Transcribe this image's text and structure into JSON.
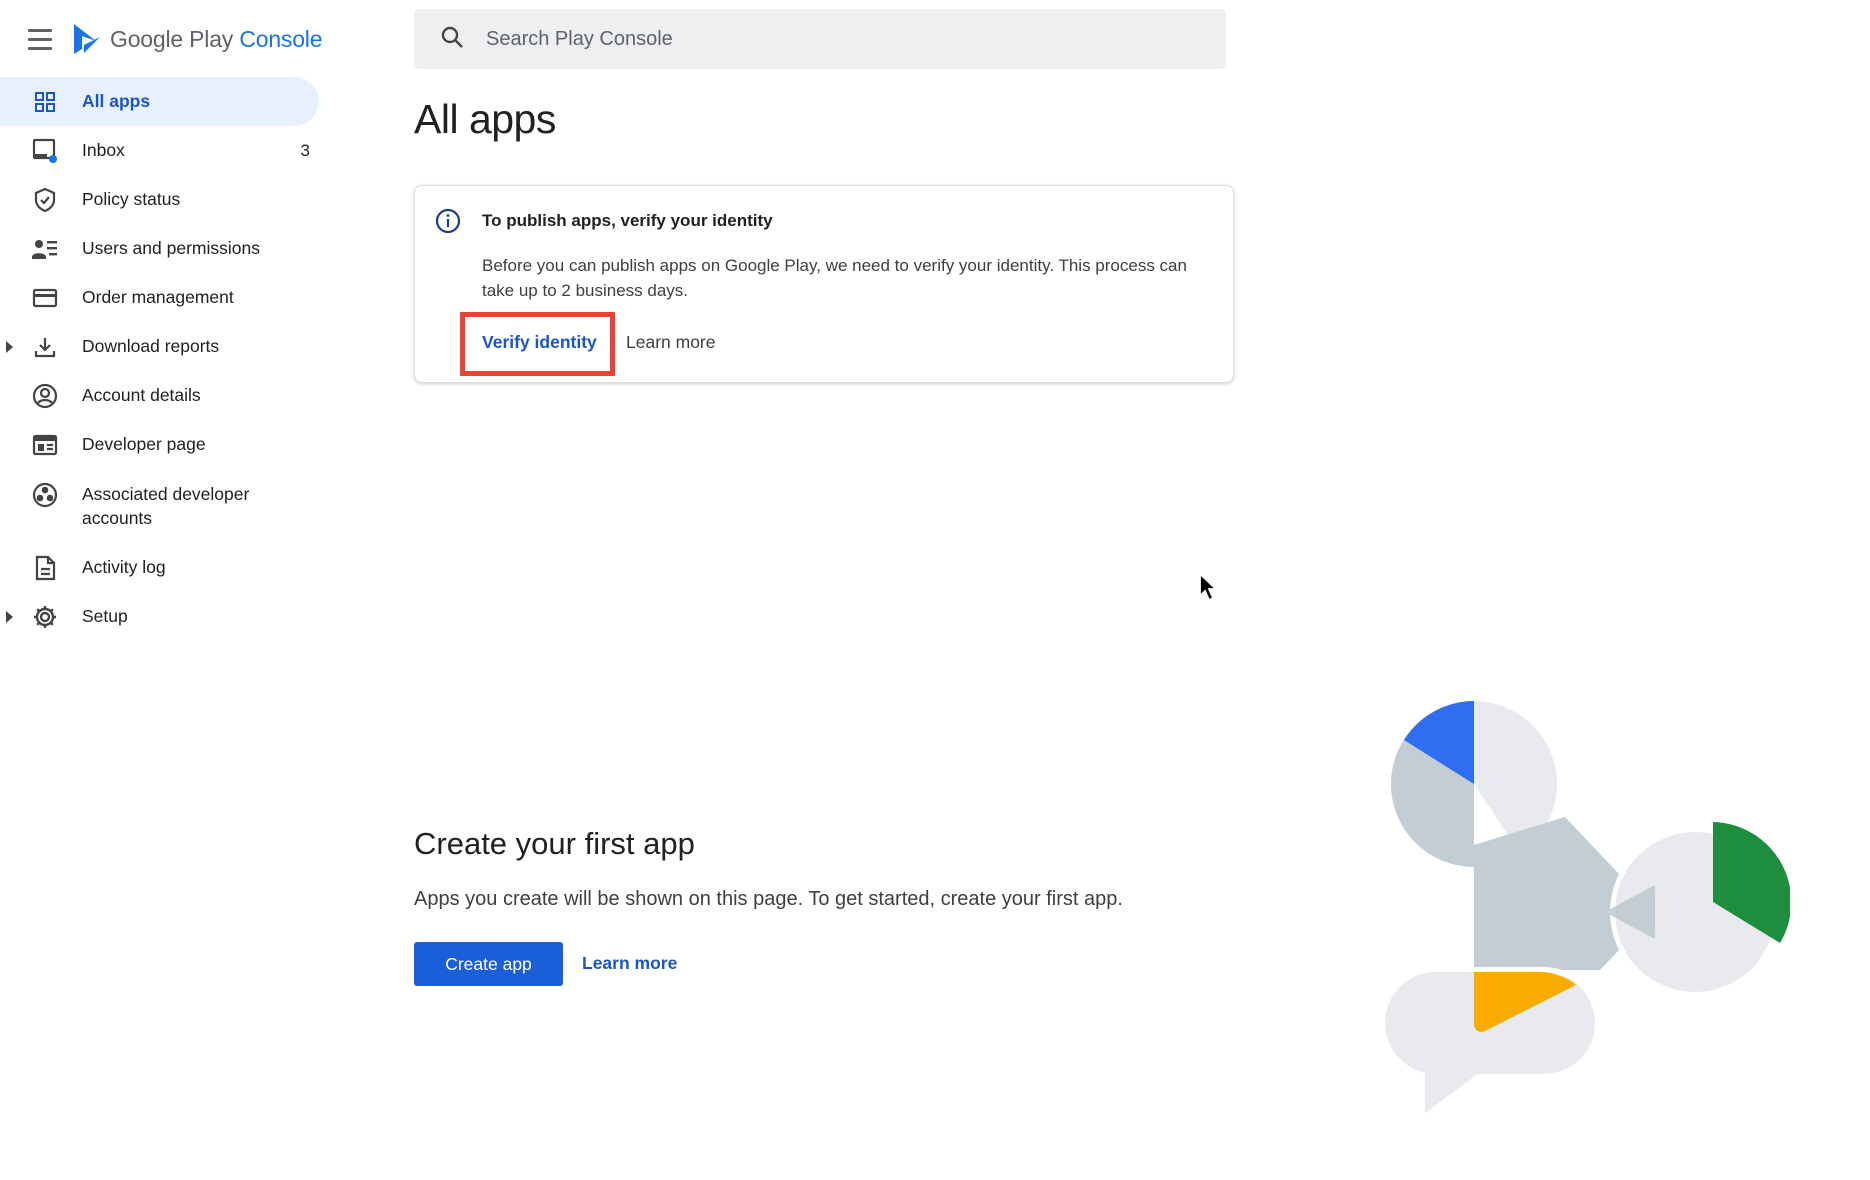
{
  "brand": {
    "google_play": "Google Play",
    "console": "Console"
  },
  "search": {
    "placeholder": "Search Play Console"
  },
  "sidebar": {
    "items": [
      {
        "label": "All apps",
        "icon": "grid-icon",
        "active": true
      },
      {
        "label": "Inbox",
        "icon": "inbox-icon",
        "count": "3"
      },
      {
        "label": "Policy status",
        "icon": "shield-check-icon"
      },
      {
        "label": "Users and permissions",
        "icon": "people-list-icon"
      },
      {
        "label": "Order management",
        "icon": "credit-card-icon"
      },
      {
        "label": "Download reports",
        "icon": "download-icon",
        "expandable": true
      },
      {
        "label": "Account details",
        "icon": "account-circle-icon"
      },
      {
        "label": "Developer page",
        "icon": "web-page-icon"
      },
      {
        "label": "Associated developer accounts",
        "icon": "linked-accounts-icon"
      },
      {
        "label": "Activity log",
        "icon": "document-icon"
      },
      {
        "label": "Setup",
        "icon": "gear-icon",
        "expandable": true
      }
    ]
  },
  "main": {
    "title": "All apps",
    "alert": {
      "title": "To publish apps, verify your identity",
      "body": "Before you can publish apps on Google Play, we need to verify your identity. This process can take up to 2 business days.",
      "verify_label": "Verify identity",
      "learn_label": "Learn more"
    },
    "create": {
      "title": "Create your first app",
      "description": "Apps you create will be shown on this page. To get started, create your first app.",
      "button_label": "Create app",
      "learn_label": "Learn more"
    }
  },
  "colors": {
    "accent": "#1a73e8",
    "active_bg": "#e8f0fe",
    "highlight_border": "#ea4335",
    "illustration_blue": "#2f6ef0",
    "illustration_green": "#1e8e3e",
    "illustration_yellow": "#f9ab00",
    "illustration_gray": "#c3cdd4",
    "illustration_light": "#e8eaed"
  }
}
